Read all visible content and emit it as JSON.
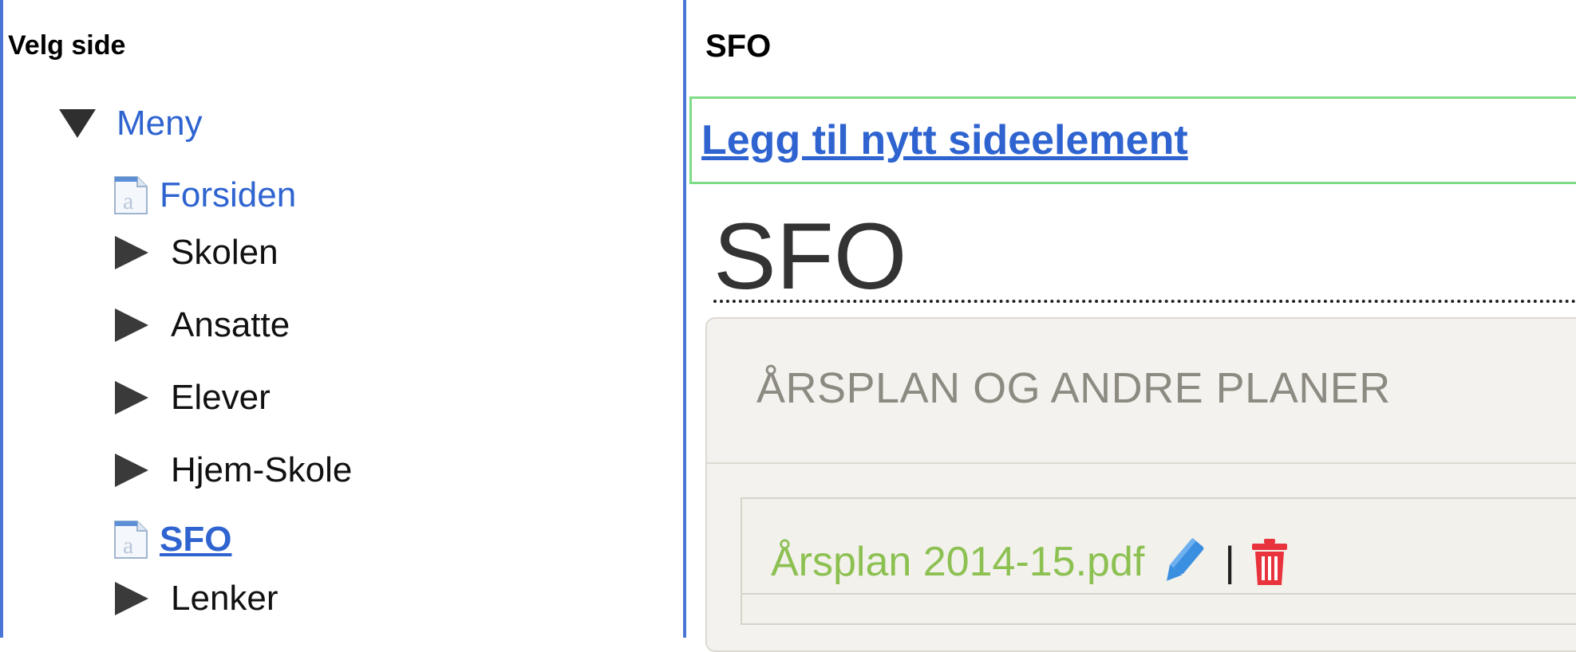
{
  "left_panel": {
    "title": "Velg side",
    "tree": {
      "root_label": "Meny",
      "items": [
        {
          "label": "Forsiden",
          "type": "page"
        },
        {
          "label": "Skolen",
          "type": "folder"
        },
        {
          "label": "Ansatte",
          "type": "folder"
        },
        {
          "label": "Elever",
          "type": "folder"
        },
        {
          "label": "Hjem-Skole",
          "type": "folder"
        },
        {
          "label": "SFO",
          "type": "page",
          "current": true
        },
        {
          "label": "Lenker",
          "type": "folder"
        }
      ]
    }
  },
  "right_panel": {
    "title": "SFO",
    "add_element_link": "Legg til nytt sideelement",
    "page_heading": "SFO",
    "section": {
      "title": "ÅRSPLAN OG ANDRE PLANER",
      "file": {
        "name": "Årsplan 2014-15.pdf",
        "separator": "|"
      }
    }
  },
  "colors": {
    "accent_blue": "#2f64d0",
    "border_blue": "#4a74d6",
    "add_bar_border": "#7fdc86",
    "file_link_green": "#8cc152",
    "trash_red": "#e8323c",
    "pencil_blue": "#3b8fe0"
  },
  "icons": {
    "expand_open": "triangle-down-icon",
    "collapsed": "triangle-right-icon",
    "page": "page-document-icon",
    "edit": "pencil-icon",
    "delete": "trash-icon"
  }
}
